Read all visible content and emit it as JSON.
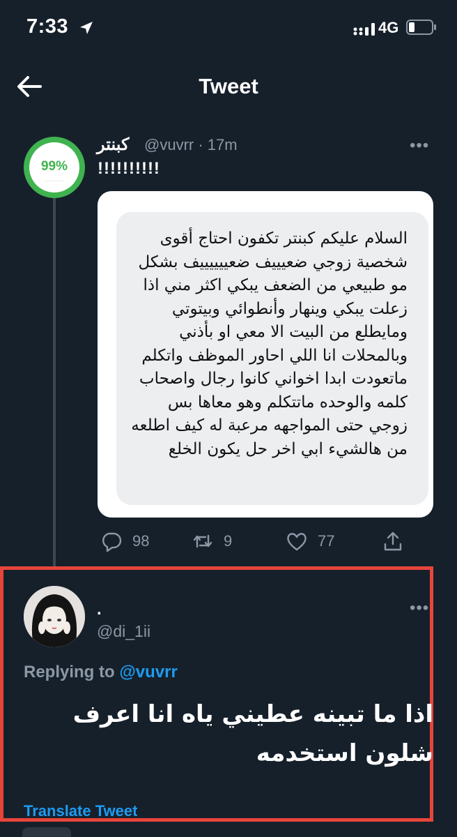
{
  "status_bar": {
    "time": "7:33",
    "network": "4G"
  },
  "header": {
    "title": "Tweet"
  },
  "tweet": {
    "avatar_text": "99%",
    "name": "كبنتر",
    "handle_time": "@vuvrr · 17m",
    "text": "!!!!!!!!!!",
    "image_text": "السلام عليكم كبنتر تكفون احتاج أقوى شخصية زوجي ضعيييف ضعييييييف بشكل مو طبيعي من الضعف يبكي اكثر مني اذا زعلت يبكي وينهار وأنطوائي وبيتوتي ومايطلع من البيت الا معي او بأذني وبالمحلات انا اللي احاور الموظف واتكلم ماتعودت ابدا اخواني كانوا رجال واصحاب كلمه والوحده ماتتكلم وهو معاها بس زوجي حتى المواجهه مرعبة له كيف اطلعه من هالشيء ابي اخر حل يكون الخلع",
    "replies": "98",
    "retweets": "9",
    "likes": "77"
  },
  "reply": {
    "name": ".",
    "handle": "@di_1ii",
    "replying_label": "Replying to",
    "replying_handle": "@vuvrr",
    "text": "اذا ما تبينه عطيني ياه انا اعرف شلون استخدمه",
    "translate_label": "Translate Tweet"
  },
  "icons": {
    "location": "location-arrow-icon",
    "signal": "signal-icon",
    "battery": "battery-icon",
    "back": "back-arrow-icon",
    "more": "more-icon",
    "reply": "reply-icon",
    "retweet": "retweet-icon",
    "like": "heart-icon",
    "share": "share-icon"
  },
  "colors": {
    "background": "#16202b",
    "accent": "#1d9bf0",
    "highlight_border": "#e8443a",
    "muted": "#8b98a5"
  }
}
